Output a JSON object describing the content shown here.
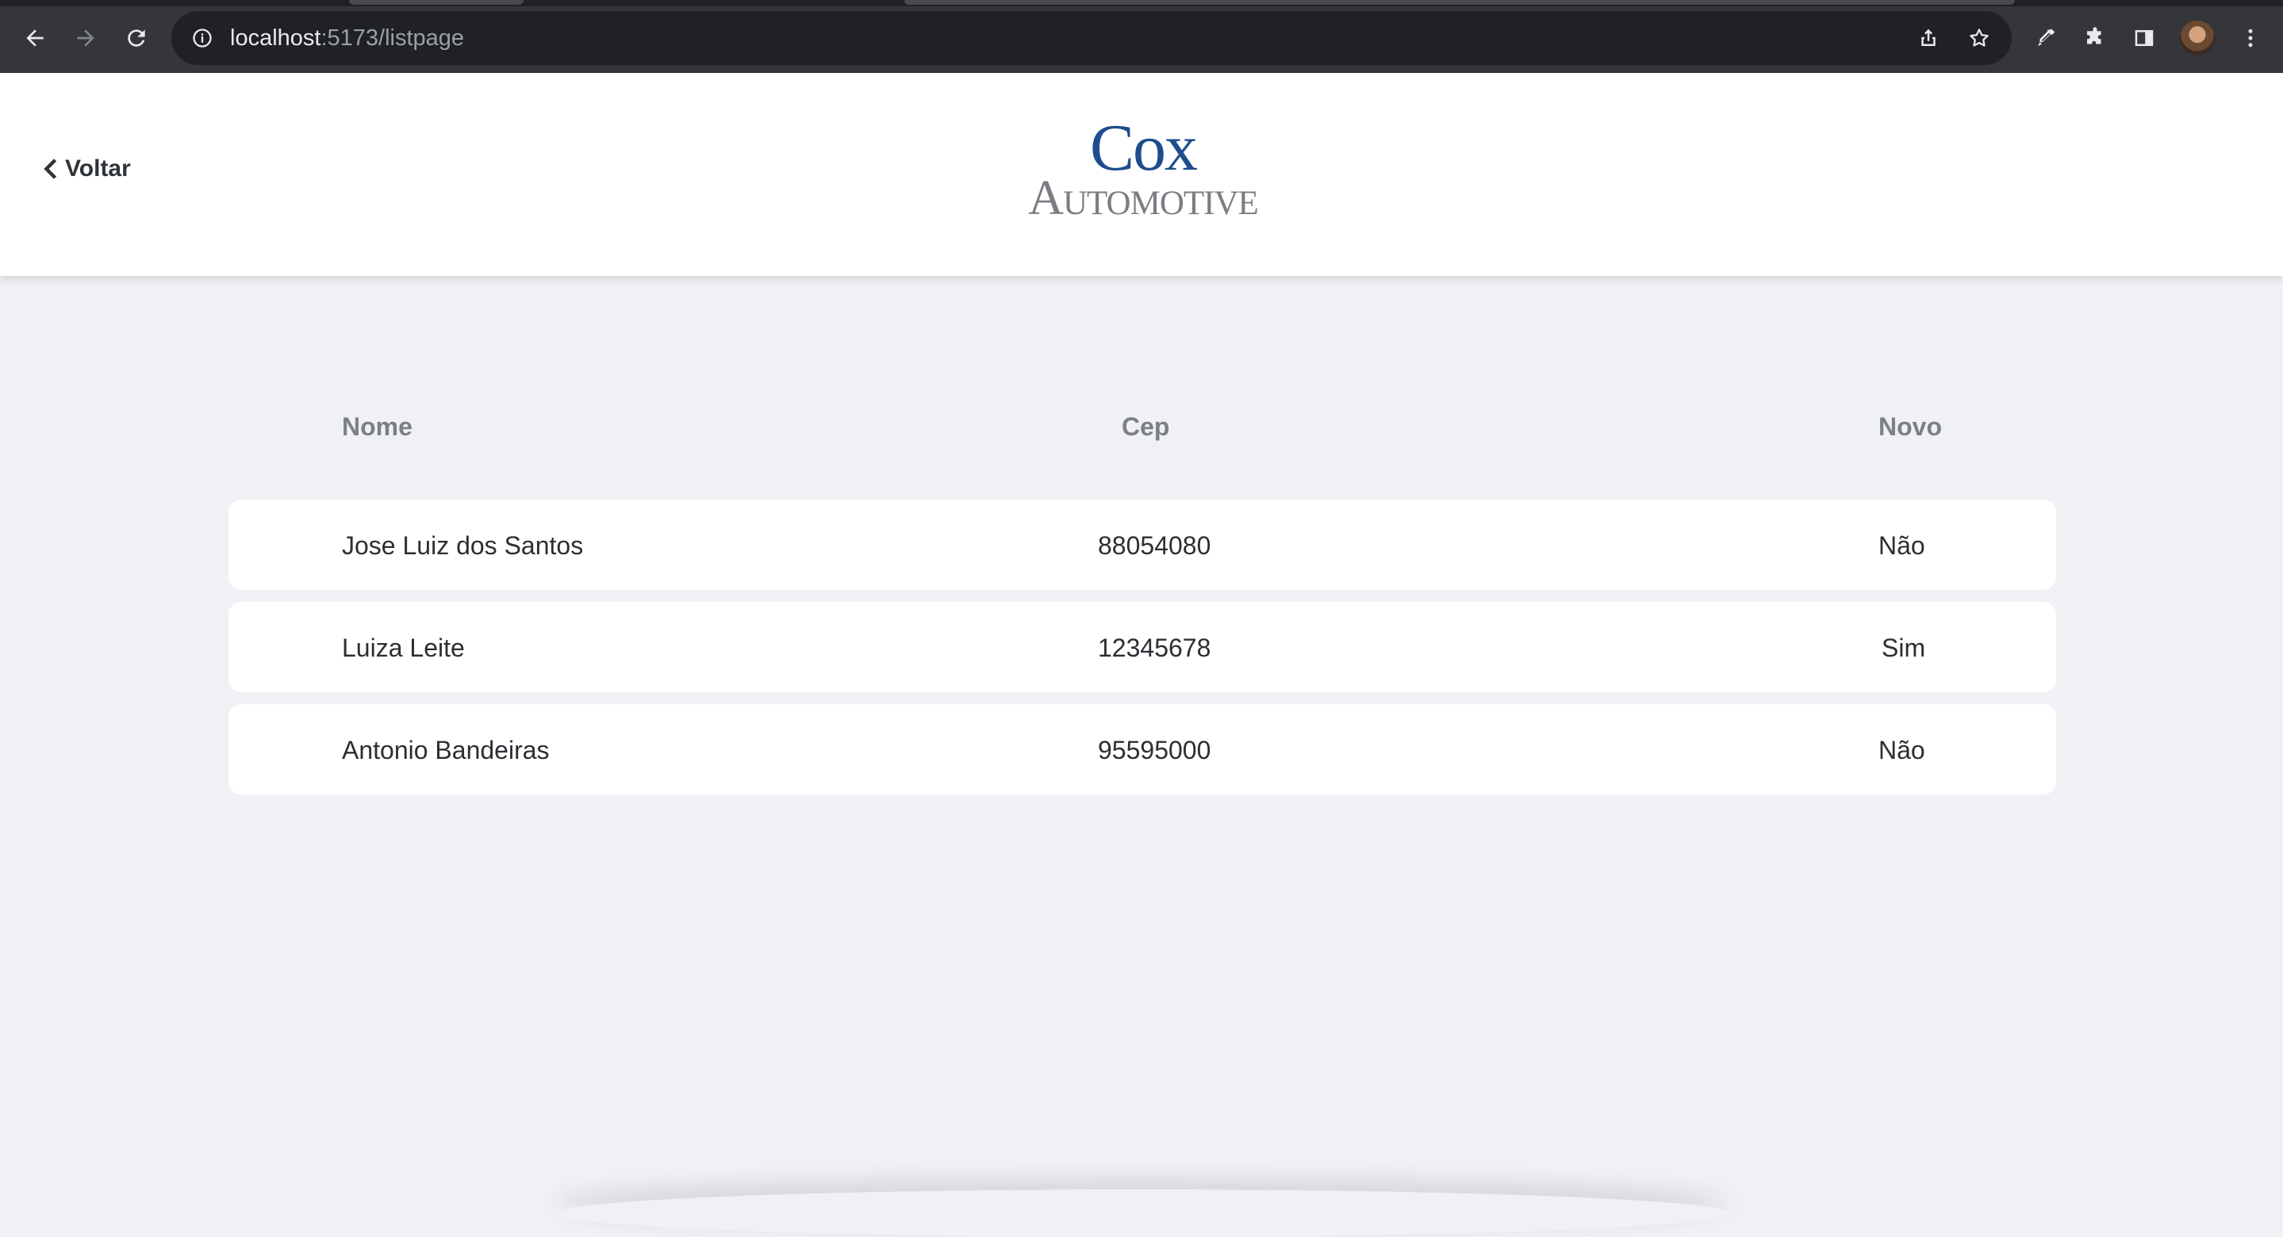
{
  "browser": {
    "url_host": "localhost",
    "url_path": ":5173/listpage"
  },
  "header": {
    "back_label": "Voltar",
    "logo_line1": "Cox",
    "logo_line2": "Automotive",
    "logo_color": "#1e4d8c"
  },
  "table": {
    "columns": [
      "Nome",
      "Cep",
      "Novo"
    ],
    "rows": [
      {
        "nome": "Jose Luiz dos Santos",
        "cep": "88054080",
        "novo": "Não"
      },
      {
        "nome": "Luiza Leite",
        "cep": "12345678",
        "novo": "Sim"
      },
      {
        "nome": "Antonio Bandeiras",
        "cep": "95595000",
        "novo": "Não"
      }
    ]
  },
  "icons": [
    "back-arrow-icon",
    "forward-arrow-icon",
    "reload-icon",
    "info-icon",
    "share-icon",
    "star-icon",
    "eyedropper-icon",
    "extensions-icon",
    "side-panel-icon",
    "menu-icon",
    "chevron-left-icon"
  ]
}
